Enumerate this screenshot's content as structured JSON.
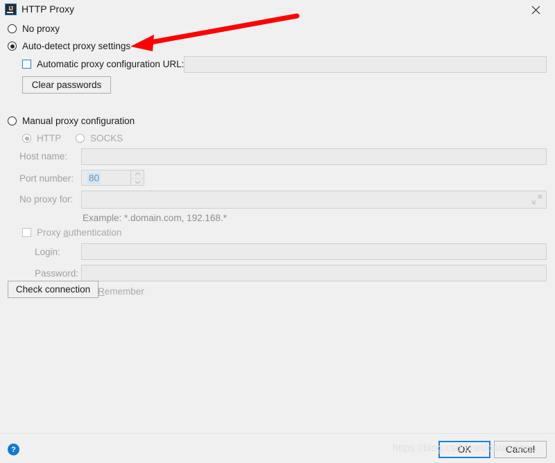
{
  "window": {
    "title": "HTTP Proxy",
    "icon": "intellij-idea-icon",
    "close_label": "✕"
  },
  "options": {
    "no_proxy": {
      "label": "No proxy",
      "selected": false
    },
    "auto_detect": {
      "label": "Auto-detect proxy settings",
      "selected": true
    },
    "manual": {
      "label": "Manual proxy configuration",
      "selected": false
    }
  },
  "auto_section": {
    "pac_checkbox_label": "Automatic proxy configuration URL:",
    "pac_checked": false,
    "pac_url_value": "",
    "clear_passwords_label": "Clear passwords"
  },
  "manual_section": {
    "protocol": {
      "http_label": "HTTP",
      "http_selected": true,
      "socks_label": "SOCKS",
      "socks_selected": false
    },
    "host_name_label": "Host name:",
    "host_name_value": "",
    "port_number_label": "Port number:",
    "port_number_value": "80",
    "no_proxy_for_label": "No proxy for:",
    "no_proxy_for_value": "",
    "example_hint": "Example: *.domain.com, 192.168.*",
    "expand_icon": "expand-icon"
  },
  "auth_section": {
    "checkbox_label_pre": "Proxy ",
    "checkbox_label_mnemonic": "a",
    "checkbox_label_post": "uthentication",
    "checked": false,
    "login_label": "Login:",
    "login_value": "",
    "password_label": "Password:",
    "password_value": "",
    "remember_label_mnemonic": "R",
    "remember_label_post": "emember",
    "remember_checked": false
  },
  "check_connection_label": "Check connection",
  "footer": {
    "help_icon": "help-icon",
    "help_glyph": "?",
    "ok_label": "OK",
    "cancel_label": "Cancel"
  },
  "annotation": {
    "arrow_color": "#ff0000",
    "arrow_points_to": "Auto-detect proxy settings"
  },
  "watermark": {
    "text": "https://blog.csdn.net/dataiyangu"
  }
}
